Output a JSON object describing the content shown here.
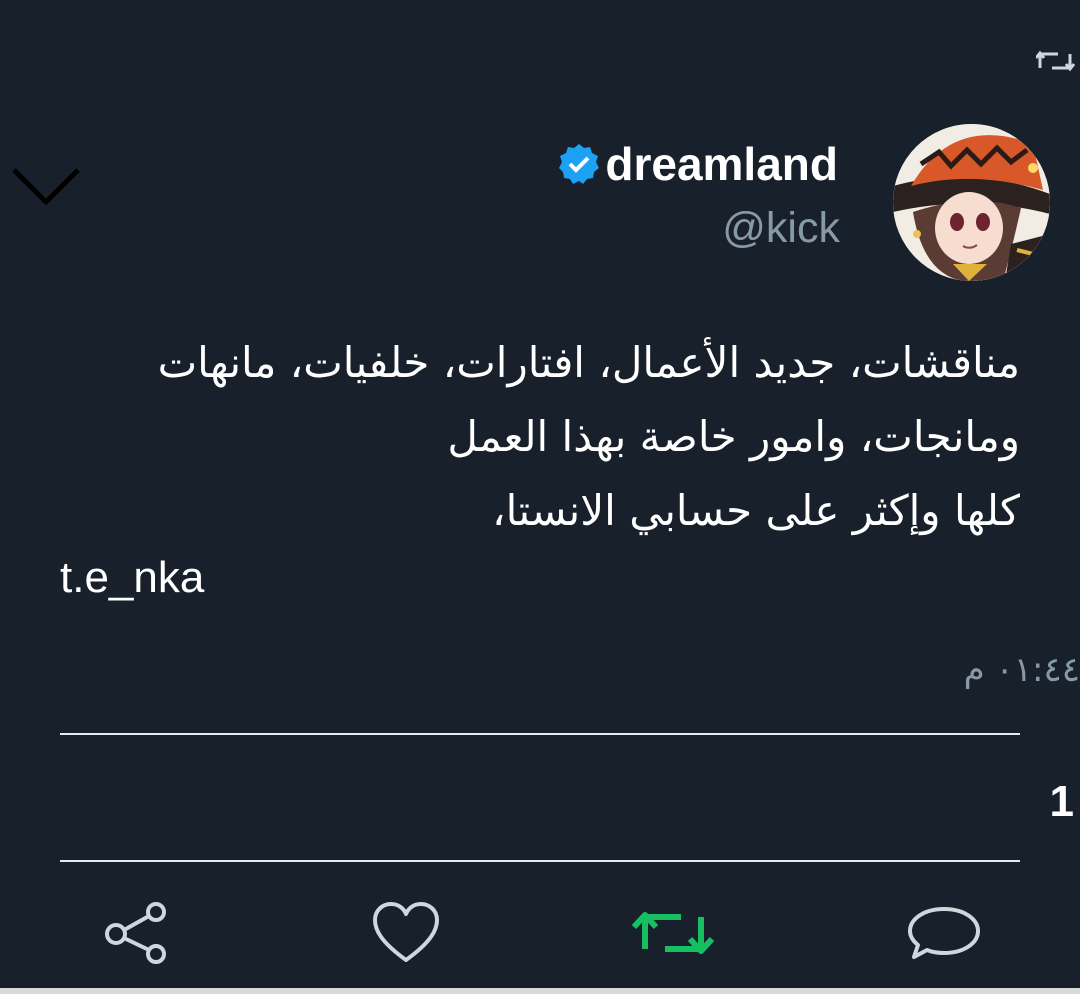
{
  "header": {
    "retweet_icon": "retweet-icon",
    "collapse_icon": "chevron-down-icon"
  },
  "user": {
    "display_name": "dreamland",
    "handle": "@kick",
    "verified": true,
    "avatar": "anime-avatar"
  },
  "tweet": {
    "text_lines": [
      "مناقشات، جديد الأعمال، افتارات، خلفيات، مانهات",
      "ومانجات، وامور خاصة بهذا العمل",
      "كلها وإكثر على حسابي الانستا،"
    ],
    "link_text": "t.e_nka",
    "timestamp": "٠١:٤٤ م"
  },
  "stats": {
    "count": "1"
  },
  "actions": [
    {
      "icon": "share-icon"
    },
    {
      "icon": "heart-icon"
    },
    {
      "icon": "retweet-icon",
      "color": "#17bf63"
    },
    {
      "icon": "reply-icon"
    }
  ],
  "colors": {
    "background": "#17202b",
    "secondary_text": "#8899a6",
    "verified": "#1da1f2",
    "retweet_active": "#17bf63"
  }
}
